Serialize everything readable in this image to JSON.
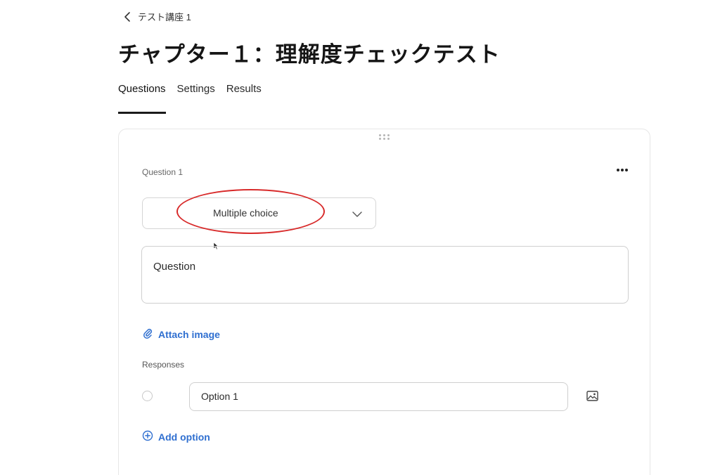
{
  "breadcrumb": {
    "label": "テスト講座 1"
  },
  "page": {
    "title": "チャプター１：理解度チェックテスト"
  },
  "tabs": [
    {
      "label": "Questions",
      "active": true
    },
    {
      "label": "Settings",
      "active": false
    },
    {
      "label": "Results",
      "active": false
    }
  ],
  "question": {
    "label": "Question 1",
    "type": "Multiple choice",
    "prompt_placeholder": "Question",
    "attach_image_label": "Attach image",
    "responses_label": "Responses",
    "options": [
      {
        "label": "Option 1"
      }
    ],
    "add_option_label": "Add option"
  },
  "colors": {
    "accent": "#2f6fd0",
    "highlight": "#d82a2a"
  },
  "icons": {
    "back": "chevron-left-icon",
    "drag": "drag-handle-icon",
    "more": "more-horizontal-icon",
    "dropdown": "chevron-down-icon",
    "attach": "paperclip-icon",
    "image": "image-icon",
    "add": "plus-circle-icon",
    "cursor": "mouse-cursor-icon"
  }
}
